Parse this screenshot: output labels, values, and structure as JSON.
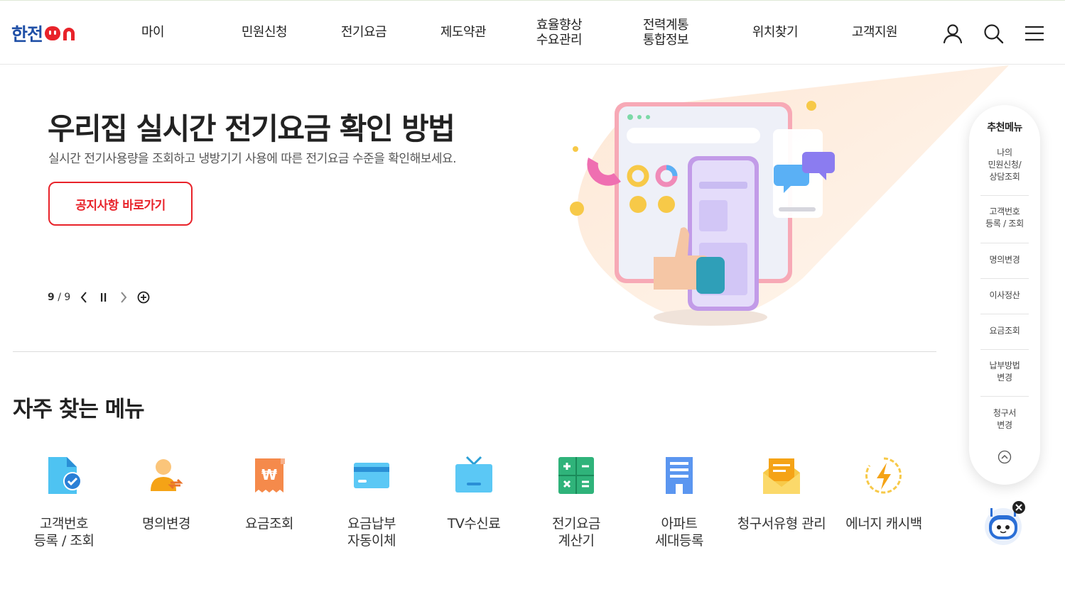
{
  "header": {
    "logo": {
      "text_han": "한전",
      "text_on": "ON"
    },
    "nav": [
      {
        "label": "마이"
      },
      {
        "label": "민원신청"
      },
      {
        "label": "전기요금"
      },
      {
        "label": "제도약관"
      },
      {
        "label": "효율향상\n수요관리"
      },
      {
        "label": "전력계통\n통합정보"
      },
      {
        "label": "위치찾기"
      },
      {
        "label": "고객지원"
      }
    ],
    "icons": [
      "user-icon",
      "search-icon",
      "menu-icon"
    ]
  },
  "hero": {
    "title": "우리집 실시간 전기요금 확인 방법",
    "subtitle": "실시간 전기사용량을 조회하고 냉방기기 사용에 따른 전기요금 수준을 확인해보세요.",
    "button": "공지사항 바로가기",
    "pager": {
      "current": "9",
      "sep": "/",
      "total": "9"
    }
  },
  "quick_menu": {
    "title": "자주 찾는 메뉴",
    "items": [
      {
        "label": "고객번호\n등록 / 조회",
        "icon": "document-check-icon"
      },
      {
        "label": "명의변경",
        "icon": "person-change-icon"
      },
      {
        "label": "요금조회",
        "icon": "won-receipt-icon"
      },
      {
        "label": "요금납부\n자동이체",
        "icon": "credit-card-icon"
      },
      {
        "label": "TV수신료",
        "icon": "tv-icon"
      },
      {
        "label": "전기요금\n계산기",
        "icon": "calculator-icon"
      },
      {
        "label": "아파트\n세대등록",
        "icon": "apartment-icon"
      },
      {
        "label": "청구서유형 관리",
        "icon": "envelope-icon"
      },
      {
        "label": "에너지 캐시백",
        "icon": "energy-bolt-icon"
      }
    ]
  },
  "side_menu": {
    "title": "추천메뉴",
    "items": [
      {
        "label": "나의\n민원신청/\n상담조회"
      },
      {
        "label": "고객번호\n등록 / 조회"
      },
      {
        "label": "명의변경"
      },
      {
        "label": "이사정산"
      },
      {
        "label": "요금조회"
      },
      {
        "label": "납부방법\n변경"
      },
      {
        "label": "청구서\n변경"
      }
    ]
  },
  "colors": {
    "brand_blue": "#1f4fa6",
    "brand_red": "#e8232a",
    "hero_bg": "#fdf0e2"
  }
}
